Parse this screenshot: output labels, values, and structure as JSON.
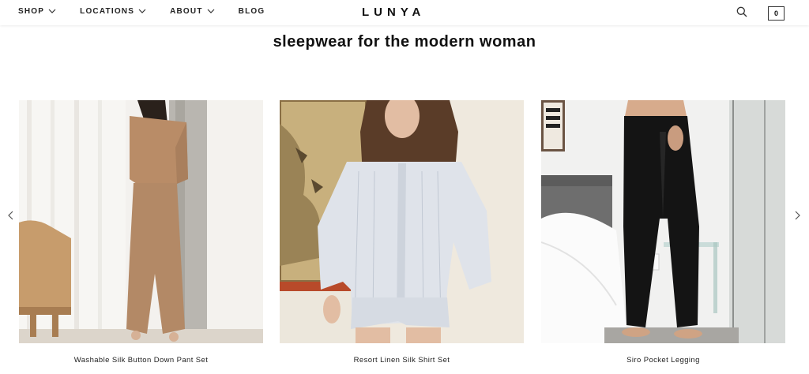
{
  "header": {
    "nav": [
      {
        "label": "SHOP",
        "has_dropdown": true
      },
      {
        "label": "LOCATIONS",
        "has_dropdown": true
      },
      {
        "label": "ABOUT",
        "has_dropdown": true
      },
      {
        "label": "BLOG",
        "has_dropdown": false
      }
    ],
    "logo": "LUNYA",
    "search_icon": "search-icon",
    "cart_count": "0"
  },
  "main": {
    "headline": "sleepwear for the modern woman",
    "carousel": {
      "prev_icon": "chevron-left-icon",
      "next_icon": "chevron-right-icon",
      "products": [
        {
          "name": "Washable Silk Button Down Pant Set"
        },
        {
          "name": "Resort Linen Silk Shirt Set"
        },
        {
          "name": "Siro Pocket Legging"
        }
      ]
    }
  },
  "colors": {
    "text": "#111111",
    "background": "#ffffff",
    "accent": "#000000"
  }
}
